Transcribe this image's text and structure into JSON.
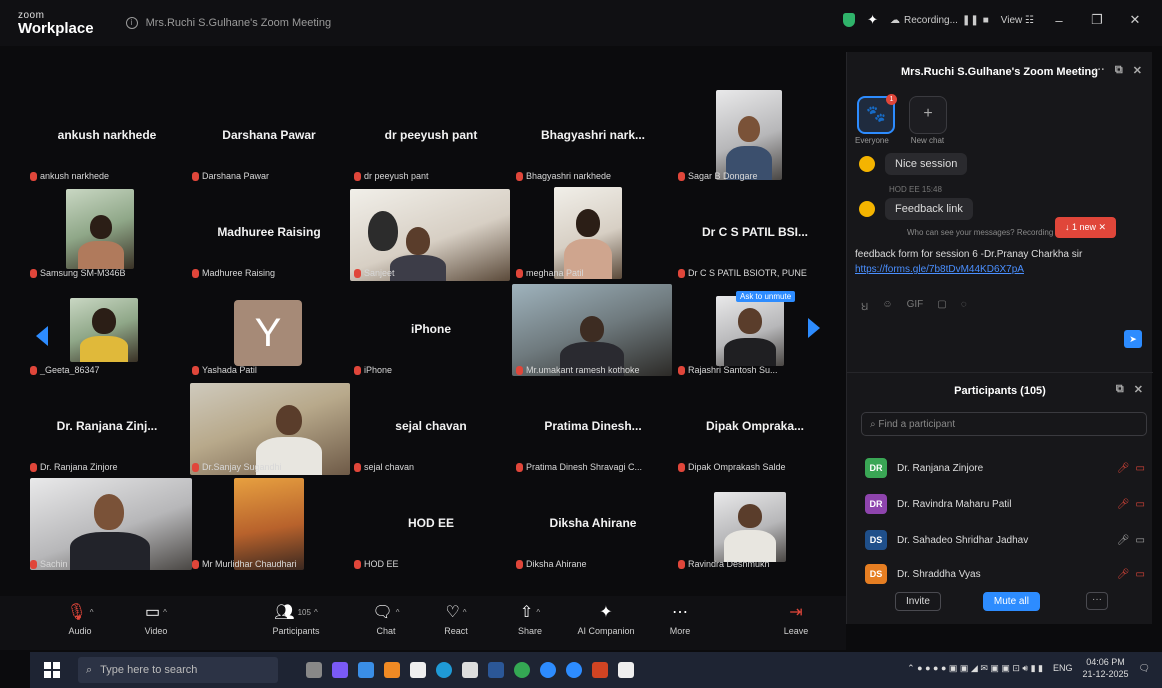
{
  "app": {
    "brand_top": "zoom",
    "brand_main": "Workplace",
    "meeting_title": "Mrs.Ruchi S.Gulhane's Zoom Meeting",
    "recording": "Recording...",
    "view": "View"
  },
  "tiles": [
    {
      "big": "ankush narkhede",
      "tag": "ankush narkhede"
    },
    {
      "big": "Darshana Pawar",
      "tag": "Darshana Pawar"
    },
    {
      "big": "dr peeyush pant",
      "tag": "dr peeyush pant"
    },
    {
      "big": "Bhagyashri nark...",
      "tag": "Bhagyashri narkhede"
    },
    {
      "big": "",
      "tag": "Sagar B Dongare"
    },
    {
      "big": "",
      "tag": "Samsung SM-M346B"
    },
    {
      "big": "Madhuree Raising",
      "tag": "Madhuree Raising"
    },
    {
      "big": "",
      "tag": "Sanjeet"
    },
    {
      "big": "",
      "tag": "meghana Patil"
    },
    {
      "big": "Dr C S PATIL BSI...",
      "tag": "Dr C S PATIL BSIOTR, PUNE"
    },
    {
      "big": "",
      "tag": "_Geeta_86347"
    },
    {
      "big": "",
      "tag": "Yashada Patil"
    },
    {
      "big": "iPhone",
      "tag": "iPhone"
    },
    {
      "big": "",
      "tag": "Mr.umakant ramesh kothoke"
    },
    {
      "big": "",
      "tag": "Rajashri Santosh Su..."
    },
    {
      "big": "Dr. Ranjana Zinj...",
      "tag": "Dr. Ranjana Zinjore"
    },
    {
      "big": "",
      "tag": "Dr.Sanjay Sugandhi"
    },
    {
      "big": "sejal chavan",
      "tag": "sejal chavan"
    },
    {
      "big": "Pratima Dinesh...",
      "tag": "Pratima Dinesh Shravagi C..."
    },
    {
      "big": "Dipak Ompraka...",
      "tag": "Dipak Omprakash Salde"
    },
    {
      "big": "",
      "tag": "Sachin"
    },
    {
      "big": "",
      "tag": "Mr Murlidhar Chaudhari"
    },
    {
      "big": "HOD EE",
      "tag": "HOD EE"
    },
    {
      "big": "Diksha Ahirane",
      "tag": "Diksha Ahirane"
    },
    {
      "big": "",
      "tag": "Ravindra Deshmukh"
    }
  ],
  "avatar_letter": "Y",
  "ask_to_unmute": "Ask to unmute",
  "chat": {
    "title": "Mrs.Ruchi S.Gulhane's Zoom Meeting",
    "tab_everyone": "Everyone",
    "tab_new": "New chat",
    "notif_count": "1",
    "msg1": "Nice session",
    "sender2": "HOD EE 15:48",
    "msg2": "Feedback link",
    "jump": "1 new",
    "who_can_see": "Who can see your messages? Recording on",
    "link_text": "feedback form for session 6 -Dr.Pranay Charkha sir",
    "link_url": "https://forms.gle/7b8tDvM44KD6X7pA"
  },
  "participants": {
    "title": "Participants (105)",
    "search_placeholder": "Find a participant",
    "rows": [
      {
        "initials": "DR",
        "name": "Dr. Ranjana Zinjore",
        "color": "#3aa655"
      },
      {
        "initials": "DR",
        "name": "Dr. Ravindra Maharu Patil",
        "color": "#8e44ad"
      },
      {
        "initials": "DS",
        "name": "Dr. Sahadeo Shridhar Jadhav",
        "color": "#1f4f8a"
      },
      {
        "initials": "DS",
        "name": "Dr. Shraddha Vyas",
        "color": "#e67e22"
      }
    ],
    "invite": "Invite",
    "mute_all": "Mute all"
  },
  "toolbar": {
    "audio": "Audio",
    "video": "Video",
    "participants": "Participants",
    "participants_count": "105",
    "chat": "Chat",
    "react": "React",
    "share": "Share",
    "ai": "AI Companion",
    "more": "More",
    "leave": "Leave"
  },
  "taskbar": {
    "search": "Type here to search",
    "lang": "ENG",
    "time": "04:06 PM",
    "date": "21-12-2025"
  }
}
